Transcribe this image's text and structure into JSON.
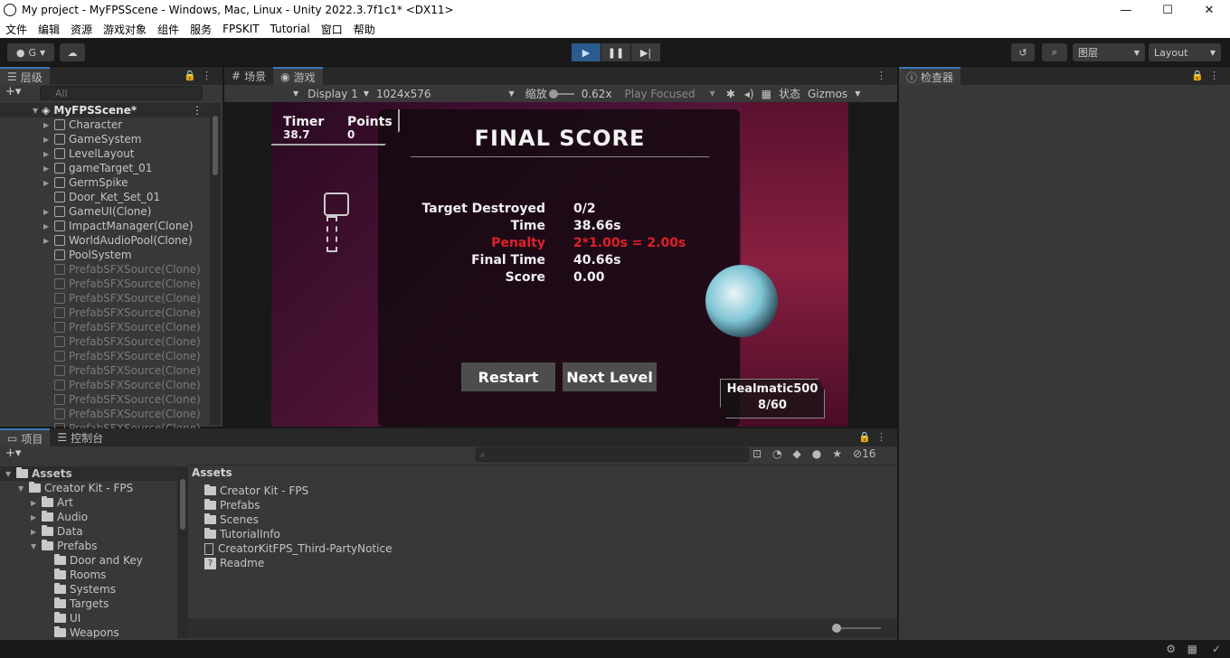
{
  "window": {
    "title": "My project - MyFPSScene - Windows, Mac, Linux - Unity 2022.3.7f1c1* <DX11>",
    "minimize": "—",
    "maximize": "☐",
    "close": "✕"
  },
  "menu": [
    "文件",
    "编辑",
    "资源",
    "游戏对象",
    "组件",
    "服务",
    "FPSKIT",
    "Tutorial",
    "窗口",
    "帮助"
  ],
  "toolbar": {
    "account": "G",
    "layers": "图层",
    "layout": "Layout"
  },
  "hierarchy": {
    "tab": "层级",
    "search_placeholder": "All",
    "scene": "MyFPSScene*",
    "items": [
      {
        "label": "Character",
        "arrow": "▶",
        "dim": false
      },
      {
        "label": "GameSystem",
        "arrow": "▶",
        "dim": false
      },
      {
        "label": "LevelLayout",
        "arrow": "▶",
        "dim": false
      },
      {
        "label": "gameTarget_01",
        "arrow": "▶",
        "dim": false
      },
      {
        "label": "GermSpike",
        "arrow": "▶",
        "dim": false
      },
      {
        "label": "Door_Ket_Set_01",
        "arrow": "",
        "dim": false
      },
      {
        "label": "GameUI(Clone)",
        "arrow": "▶",
        "dim": false
      },
      {
        "label": "ImpactManager(Clone)",
        "arrow": "▶",
        "dim": false
      },
      {
        "label": "WorldAudioPool(Clone)",
        "arrow": "▶",
        "dim": false
      },
      {
        "label": "PoolSystem",
        "arrow": "",
        "dim": false
      },
      {
        "label": "PrefabSFXSource(Clone)",
        "arrow": "",
        "dim": true
      },
      {
        "label": "PrefabSFXSource(Clone)",
        "arrow": "",
        "dim": true
      },
      {
        "label": "PrefabSFXSource(Clone)",
        "arrow": "",
        "dim": true
      },
      {
        "label": "PrefabSFXSource(Clone)",
        "arrow": "",
        "dim": true
      },
      {
        "label": "PrefabSFXSource(Clone)",
        "arrow": "",
        "dim": true
      },
      {
        "label": "PrefabSFXSource(Clone)",
        "arrow": "",
        "dim": true
      },
      {
        "label": "PrefabSFXSource(Clone)",
        "arrow": "",
        "dim": true
      },
      {
        "label": "PrefabSFXSource(Clone)",
        "arrow": "",
        "dim": true
      },
      {
        "label": "PrefabSFXSource(Clone)",
        "arrow": "",
        "dim": true
      },
      {
        "label": "PrefabSFXSource(Clone)",
        "arrow": "",
        "dim": true
      },
      {
        "label": "PrefabSFXSource(Clone)",
        "arrow": "",
        "dim": true
      },
      {
        "label": "PrefabSFXSource(Clone)",
        "arrow": "",
        "dim": true
      }
    ]
  },
  "gameview": {
    "tab_scene": "场景",
    "tab_game": "游戏",
    "display": "Display 1",
    "resolution": "1024x576",
    "scale_label": "缩放",
    "scale": "0.62x",
    "play_mode": "Play Focused",
    "stats": "状态",
    "gizmos": "Gizmos"
  },
  "game": {
    "timer_label": "Timer",
    "timer_value": "38.7",
    "points_label": "Points",
    "points_value": "0",
    "heading": "FINAL SCORE",
    "rows": [
      {
        "label": "Target Destroyed",
        "value": "0/2",
        "red": false
      },
      {
        "label": "Time",
        "value": "38.66s",
        "red": false
      },
      {
        "label": "Penalty",
        "value": "2*1.00s = 2.00s",
        "red": true
      },
      {
        "label": "Final Time",
        "value": "40.66s",
        "red": false
      },
      {
        "label": "Score",
        "value": "0.00",
        "red": false
      }
    ],
    "restart": "Restart",
    "next_level": "Next Level",
    "weapon": "Healmatic500",
    "ammo": "8/60"
  },
  "inspector": {
    "tab": "检查器"
  },
  "project": {
    "tab_project": "项目",
    "tab_console": "控制台",
    "hidden_count": "16",
    "breadcrumb": "Assets",
    "tree": [
      {
        "label": "Assets",
        "depth": 0,
        "arrow": "▼",
        "bold": true
      },
      {
        "label": "Creator Kit - FPS",
        "depth": 1,
        "arrow": "▼"
      },
      {
        "label": "Art",
        "depth": 2,
        "arrow": "▶"
      },
      {
        "label": "Audio",
        "depth": 2,
        "arrow": "▶"
      },
      {
        "label": "Data",
        "depth": 2,
        "arrow": "▶"
      },
      {
        "label": "Prefabs",
        "depth": 2,
        "arrow": "▼"
      },
      {
        "label": "Door and Key",
        "depth": 3,
        "arrow": ""
      },
      {
        "label": "Rooms",
        "depth": 3,
        "arrow": ""
      },
      {
        "label": "Systems",
        "depth": 3,
        "arrow": ""
      },
      {
        "label": "Targets",
        "depth": 3,
        "arrow": ""
      },
      {
        "label": "UI",
        "depth": 3,
        "arrow": ""
      },
      {
        "label": "Weapons",
        "depth": 3,
        "arrow": ""
      }
    ],
    "files": [
      {
        "label": "Creator Kit - FPS",
        "type": "folder"
      },
      {
        "label": "Prefabs",
        "type": "folder"
      },
      {
        "label": "Scenes",
        "type": "folder"
      },
      {
        "label": "TutorialInfo",
        "type": "folder"
      },
      {
        "label": "CreatorKitFPS_Third-PartyNotice",
        "type": "file"
      },
      {
        "label": "Readme",
        "type": "unknown"
      }
    ]
  }
}
